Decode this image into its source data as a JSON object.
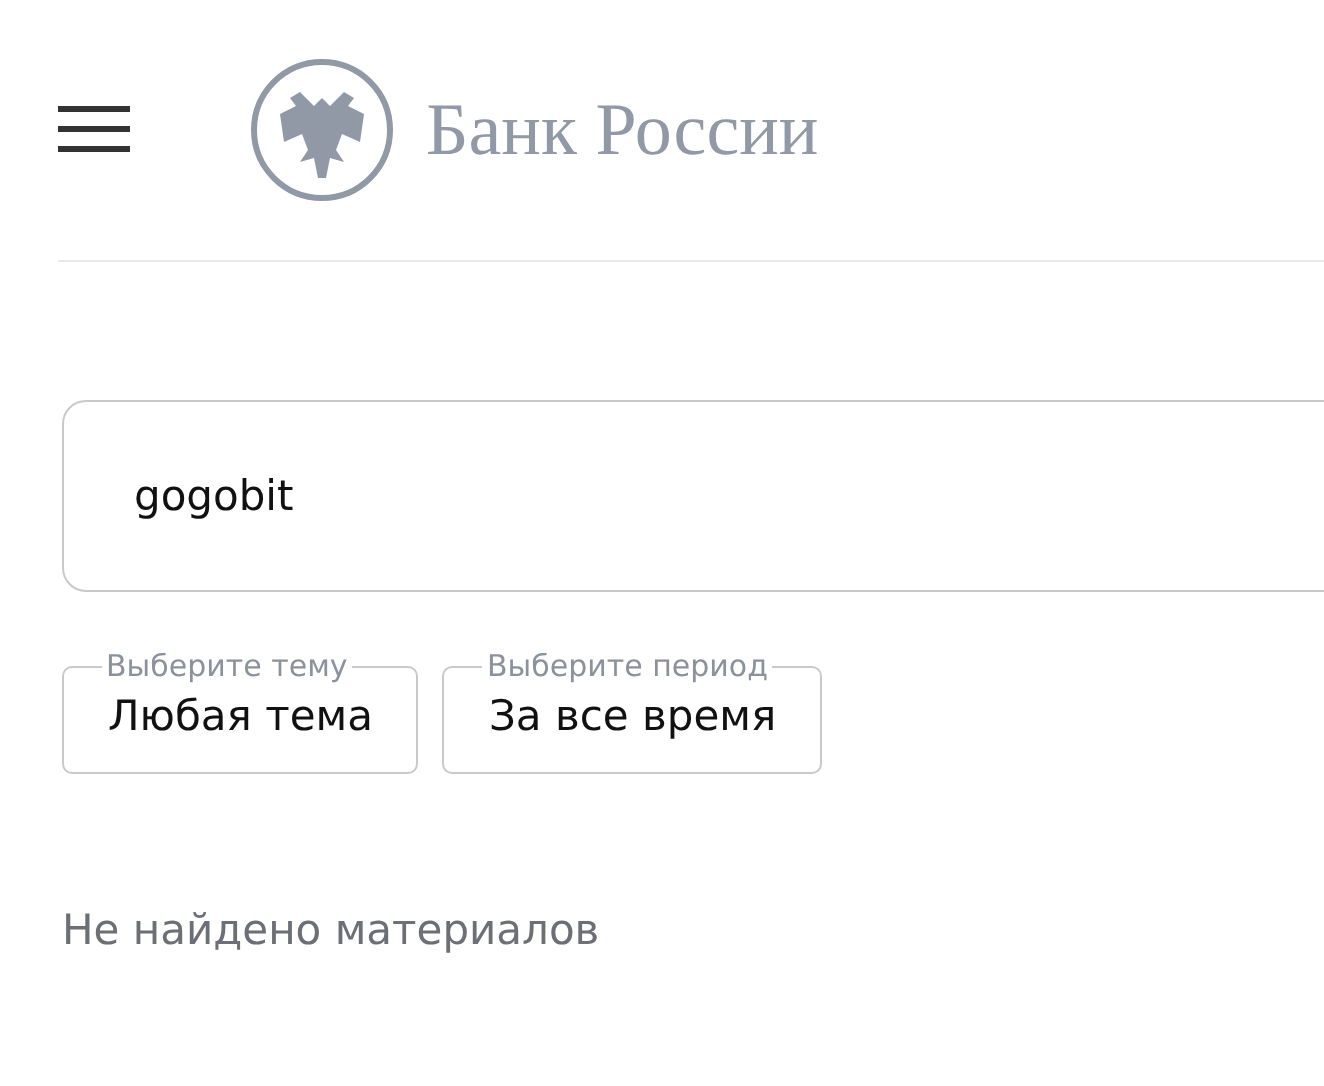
{
  "header": {
    "logo_text": "Банк России"
  },
  "search": {
    "value": "gogobit"
  },
  "filters": [
    {
      "label": "Выберите тему",
      "value": "Любая тема"
    },
    {
      "label": "Выберите период",
      "value": "За все время"
    }
  ],
  "result_message": "Не найдено материалов"
}
